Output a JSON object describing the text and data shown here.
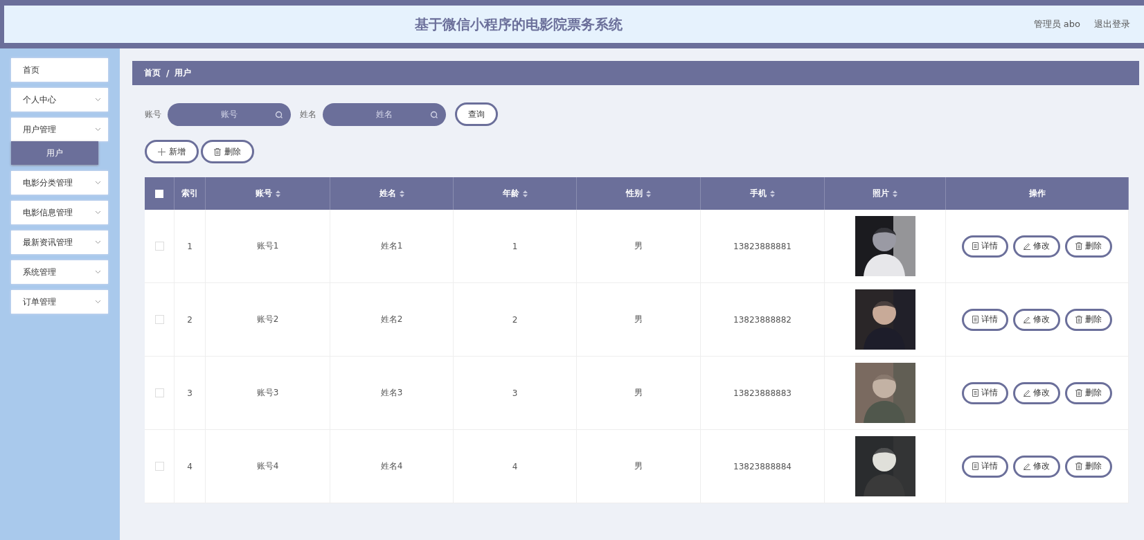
{
  "header": {
    "title": "基于微信小程序的电影院票务系统",
    "user": "管理员 abo",
    "logout": "退出登录"
  },
  "sidebar": {
    "items": [
      {
        "label": "首页",
        "kind": "link"
      },
      {
        "label": "个人中心",
        "kind": "group"
      },
      {
        "label": "用户管理",
        "kind": "group",
        "children": [
          {
            "label": "用户",
            "selected": true
          }
        ]
      },
      {
        "label": "电影分类管理",
        "kind": "group"
      },
      {
        "label": "电影信息管理",
        "kind": "group"
      },
      {
        "label": "最新资讯管理",
        "kind": "group"
      },
      {
        "label": "系统管理",
        "kind": "group"
      },
      {
        "label": "订单管理",
        "kind": "group"
      }
    ]
  },
  "breadcrumb": {
    "items": [
      "首页",
      "用户"
    ],
    "separator": "/"
  },
  "search": {
    "fields": [
      {
        "label": "账号",
        "placeholder": "账号"
      },
      {
        "label": "姓名",
        "placeholder": "姓名"
      }
    ],
    "button": "查询"
  },
  "toolbar": [
    {
      "kind": "add",
      "label": "新增"
    },
    {
      "kind": "delete",
      "label": "删除"
    }
  ],
  "table": {
    "select_all": {
      "checked": false
    },
    "columns": [
      {
        "label": "索引",
        "sortable": false
      },
      {
        "label": "账号",
        "sortable": true
      },
      {
        "label": "姓名",
        "sortable": true
      },
      {
        "label": "年龄",
        "sortable": true
      },
      {
        "label": "性别",
        "sortable": true
      },
      {
        "label": "手机",
        "sortable": true
      },
      {
        "label": "照片",
        "sortable": true
      },
      {
        "label": "操作",
        "sortable": false
      }
    ],
    "rows": [
      {
        "checked": false,
        "cells": [
          "1",
          "账号1",
          "姓名1",
          "1",
          "男",
          "13823888881"
        ],
        "photo": {
          "kind": "picture"
        },
        "actions": [
          {
            "kind": "detail",
            "label": "详情"
          },
          {
            "kind": "edit",
            "label": "修改"
          },
          {
            "kind": "delete",
            "label": "删除"
          }
        ]
      },
      {
        "checked": false,
        "cells": [
          "2",
          "账号2",
          "姓名2",
          "2",
          "男",
          "13823888882"
        ],
        "photo": {
          "kind": "picture"
        },
        "actions": [
          {
            "kind": "detail",
            "label": "详情"
          },
          {
            "kind": "edit",
            "label": "修改"
          },
          {
            "kind": "delete",
            "label": "删除"
          }
        ]
      },
      {
        "checked": false,
        "cells": [
          "3",
          "账号3",
          "姓名3",
          "3",
          "男",
          "13823888883"
        ],
        "photo": {
          "kind": "picture"
        },
        "actions": [
          {
            "kind": "detail",
            "label": "详情"
          },
          {
            "kind": "edit",
            "label": "修改"
          },
          {
            "kind": "delete",
            "label": "删除"
          }
        ]
      },
      {
        "checked": false,
        "cells": [
          "4",
          "账号4",
          "姓名4",
          "4",
          "男",
          "13823888884"
        ],
        "photo": {
          "kind": "picture"
        },
        "actions": [
          {
            "kind": "detail",
            "label": "详情"
          },
          {
            "kind": "edit",
            "label": "修改"
          },
          {
            "kind": "delete",
            "label": "删除"
          }
        ]
      }
    ]
  }
}
